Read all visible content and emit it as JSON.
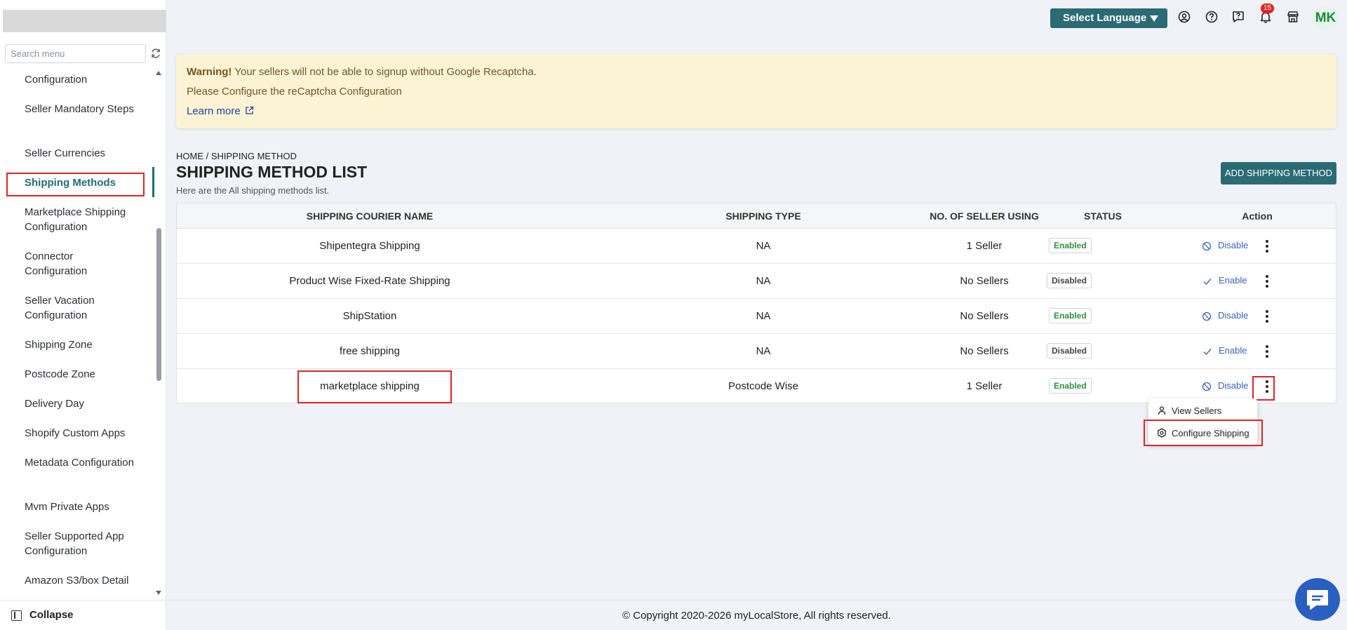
{
  "sidebar": {
    "search_placeholder": "Search menu",
    "items": [
      {
        "label": "Configuration"
      },
      {
        "label": "Seller Mandatory Steps"
      },
      {
        "label": "Seller Currencies"
      },
      {
        "label": "Shipping Methods"
      },
      {
        "label": "Marketplace Shipping Configuration"
      },
      {
        "label": "Connector Configuration"
      },
      {
        "label": "Seller Vacation Configuration"
      },
      {
        "label": "Shipping Zone"
      },
      {
        "label": "Postcode Zone"
      },
      {
        "label": "Delivery Day"
      },
      {
        "label": "Shopify Custom Apps"
      },
      {
        "label": "Metadata Configuration"
      },
      {
        "label": "Mvm Private Apps"
      },
      {
        "label": "Seller Supported App Configuration"
      },
      {
        "label": "Amazon S3/box Detail"
      }
    ],
    "collapse_label": "Collapse"
  },
  "topbar": {
    "language_label": "Select Language",
    "notification_count": "15",
    "avatar_initials": "MK"
  },
  "warning": {
    "title": "Warning!",
    "message": "Your sellers will not be able to signup without Google Recaptcha.",
    "line2": "Please Configure the reCaptcha Configuration",
    "link": "Learn more"
  },
  "header": {
    "breadcrumb": "HOME / SHIPPING METHOD",
    "title": "SHIPPING METHOD LIST",
    "subtitle": "Here are the All shipping methods list.",
    "add_button": "ADD SHIPPING METHOD"
  },
  "table": {
    "columns": [
      "SHIPPING COURIER NAME",
      "SHIPPING TYPE",
      "NO. OF SELLER USING",
      "STATUS",
      "Action"
    ],
    "rows": [
      {
        "name": "Shipentegra Shipping",
        "type": "NA",
        "sellers": "1 Seller",
        "status": "Enabled",
        "action": "Disable"
      },
      {
        "name": "Product Wise Fixed-Rate Shipping",
        "type": "NA",
        "sellers": "No Sellers",
        "status": "Disabled",
        "action": "Enable"
      },
      {
        "name": "ShipStation",
        "type": "NA",
        "sellers": "No Sellers",
        "status": "Enabled",
        "action": "Disable"
      },
      {
        "name": "free shipping",
        "type": "NA",
        "sellers": "No Sellers",
        "status": "Disabled",
        "action": "Enable"
      },
      {
        "name": "marketplace shipping",
        "type": "Postcode Wise",
        "sellers": "1 Seller",
        "status": "Enabled",
        "action": "Disable"
      }
    ]
  },
  "dropdown": {
    "items": [
      {
        "label": "View Sellers",
        "icon": "user-icon"
      },
      {
        "label": "Configure Shipping",
        "icon": "settings-icon"
      }
    ]
  },
  "footer": {
    "copyright": "© Copyright 2020-2026 myLocalStore, All rights reserved."
  },
  "colors": {
    "primary": "#2a6b74",
    "highlight": "#e02424",
    "enabled": "#2f8f3e",
    "link": "#3a63b8",
    "warning_bg": "#fcf3d4"
  }
}
